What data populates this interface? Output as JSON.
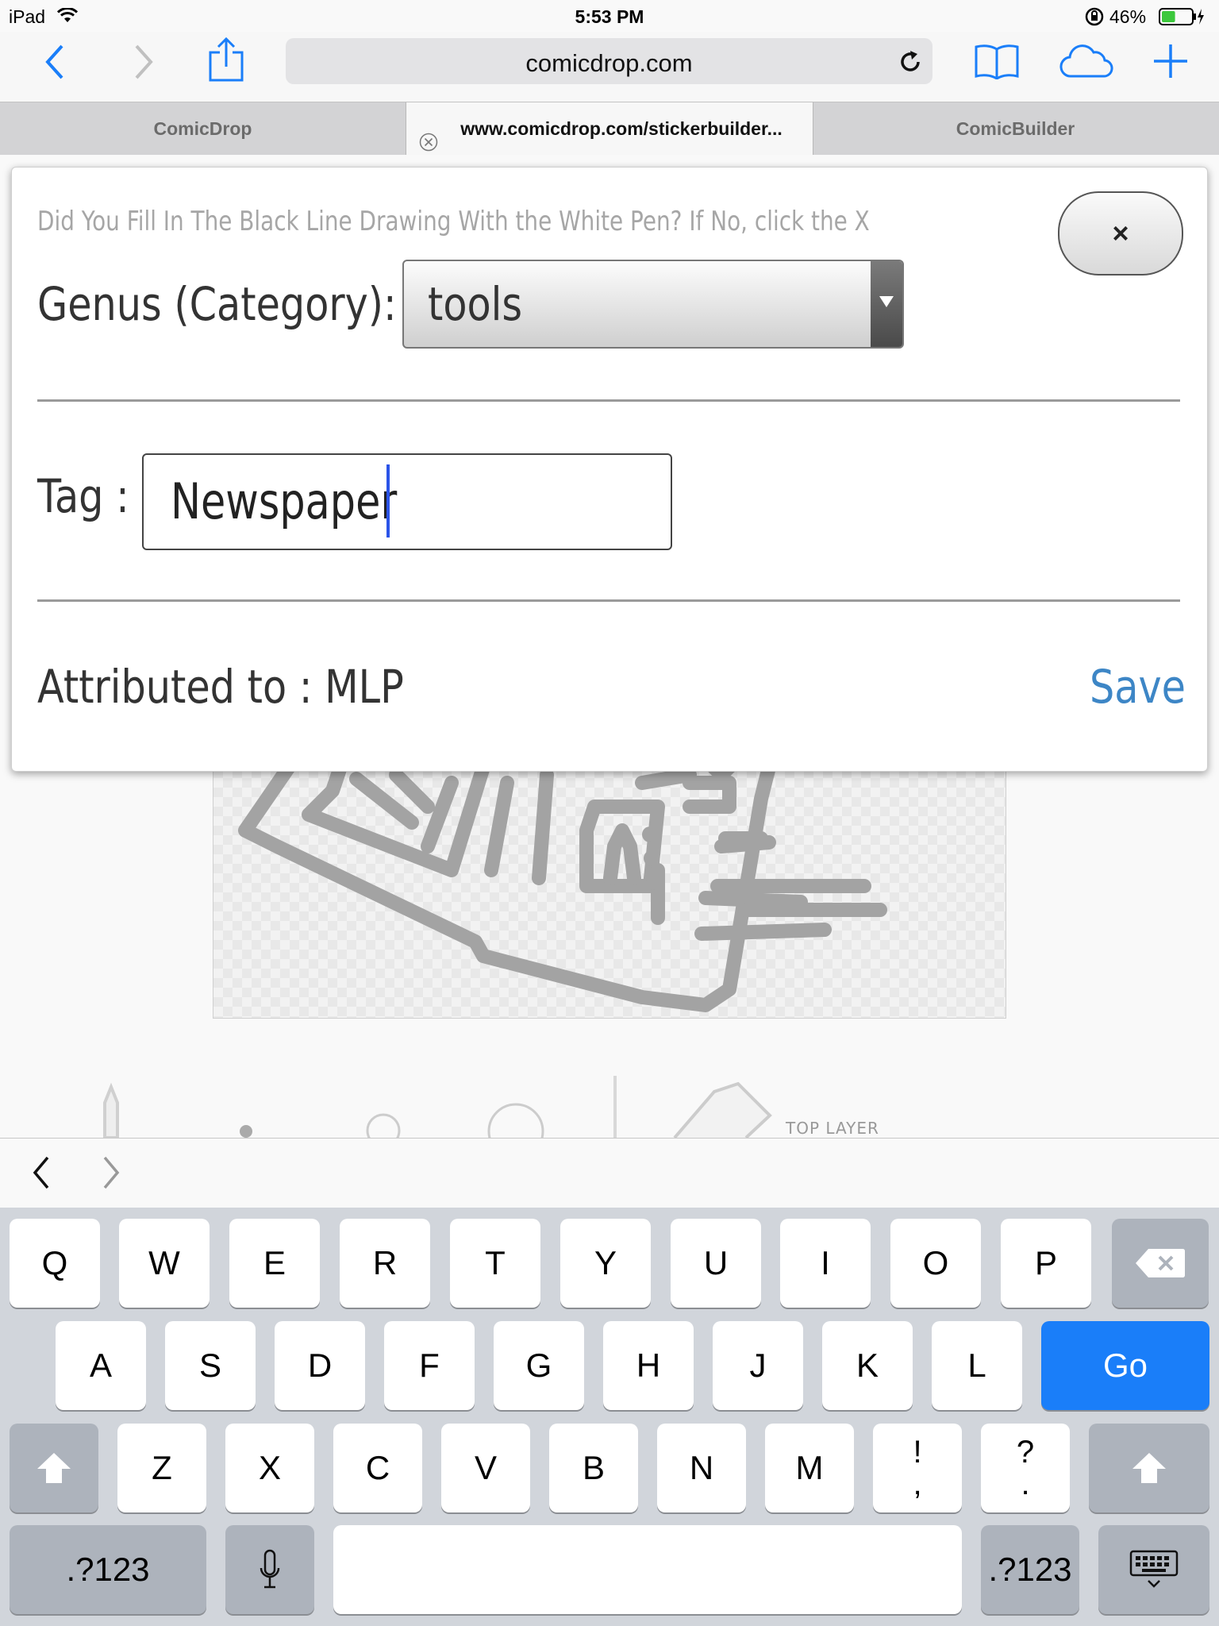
{
  "status_bar": {
    "device": "iPad",
    "time": "5:53 PM",
    "battery_percent": "46%",
    "battery_level": 0.46,
    "icons": [
      "wifi-icon",
      "rotation-lock-icon",
      "battery-charging-icon"
    ]
  },
  "toolbar": {
    "url": "comicdrop.com",
    "icons": [
      "back-icon",
      "forward-icon",
      "share-icon",
      "reload-icon",
      "bookmarks-icon",
      "icloud-tabs-icon",
      "new-tab-icon"
    ],
    "accent": "#1a7ef9"
  },
  "tabs": [
    {
      "label": "ComicDrop",
      "active": false
    },
    {
      "label": "www.comicdrop.com/stickerbuilder...",
      "active": true
    },
    {
      "label": "ComicBuilder",
      "active": false
    }
  ],
  "modal": {
    "notice": "Did You Fill In The Black Line Drawing With the White Pen? If No, click the X",
    "close_label": "×",
    "genus_label": "Genus (Category):",
    "genus_value": "tools",
    "tag_label": "Tag :",
    "tag_value": "Newspaper",
    "attributed_label": "Attributed to : MLP",
    "save_label": "Save",
    "save_color": "#3d86c6"
  },
  "tools_strip": {
    "layer_label": "TOP LAYER"
  },
  "keyboard": {
    "row1": [
      "Q",
      "W",
      "E",
      "R",
      "T",
      "Y",
      "U",
      "I",
      "O",
      "P"
    ],
    "row2": [
      "A",
      "S",
      "D",
      "F",
      "G",
      "H",
      "J",
      "K",
      "L"
    ],
    "row3": [
      "Z",
      "X",
      "C",
      "V",
      "B",
      "N",
      "M"
    ],
    "punct1": {
      "top": "!",
      "bottom": ","
    },
    "punct2": {
      "top": "?",
      "bottom": "."
    },
    "go_label": "Go",
    "numbers_label": ".?123",
    "go_color": "#1a7ef9"
  }
}
